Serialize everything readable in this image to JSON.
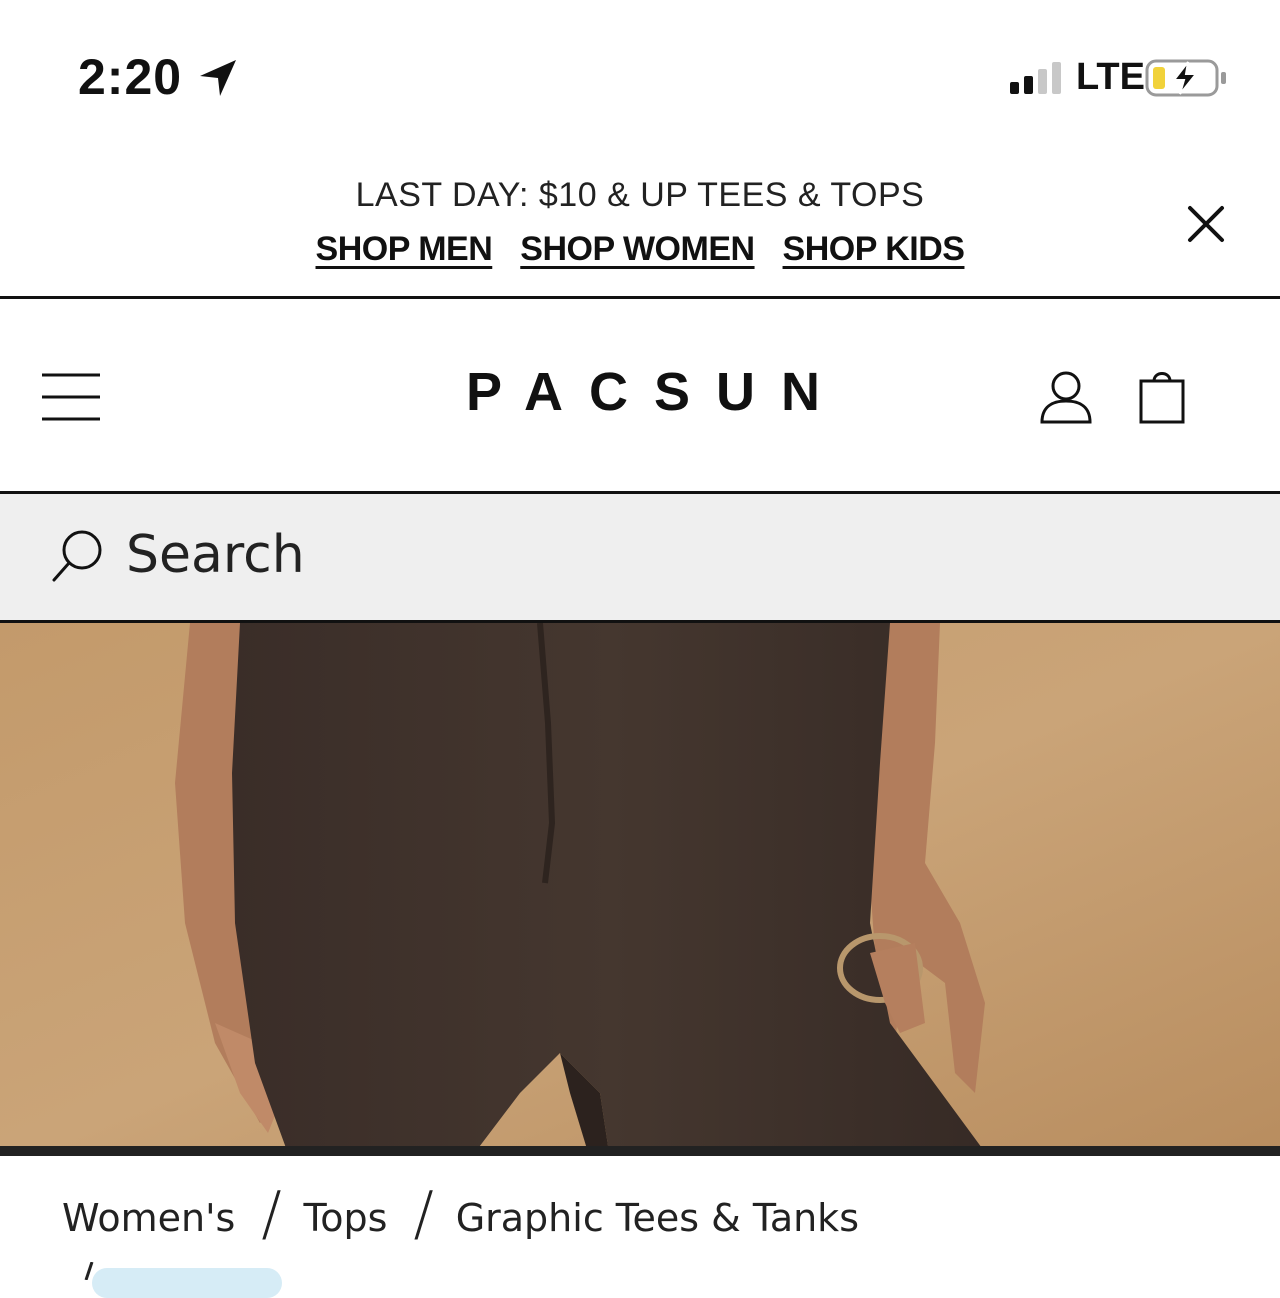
{
  "status_bar": {
    "time": "2:20",
    "network": "LTE",
    "icons": [
      "location-arrow-icon",
      "signal-icon",
      "battery-charging-icon"
    ]
  },
  "promo": {
    "text": "LAST DAY: $10 & UP TEES & TOPS",
    "links": [
      "SHOP MEN",
      "SHOP WOMEN",
      "SHOP KIDS"
    ]
  },
  "header": {
    "logo": "PACSUN",
    "icons": [
      "menu-icon",
      "account-icon",
      "shopping-bag-icon"
    ]
  },
  "search": {
    "placeholder": "Search"
  },
  "breadcrumb": {
    "items": [
      "Women's",
      "Tops",
      "Graphic Tees & Tanks"
    ],
    "separator": "/"
  },
  "colors": {
    "text": "#111111",
    "search_bg": "#efefef",
    "hero_bg": "#c49a6a",
    "pants": "#3d302b"
  }
}
